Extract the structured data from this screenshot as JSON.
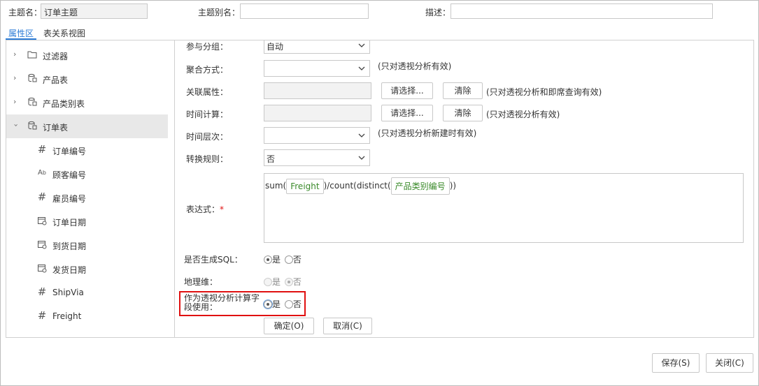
{
  "header": {
    "topic_name_label": "主题名：",
    "topic_name_value": "订单主题",
    "alias_label": "主题别名：",
    "alias_value": "",
    "desc_label": "描述：",
    "desc_value": ""
  },
  "tabs": [
    {
      "label": "属性区",
      "active": true
    },
    {
      "label": "表关系视图",
      "active": false
    }
  ],
  "tree": [
    {
      "label": "过滤器",
      "icon": "folder-icon",
      "expandable": true,
      "level": 0
    },
    {
      "label": "产品表",
      "icon": "table-icon",
      "expandable": true,
      "level": 0
    },
    {
      "label": "产品类别表",
      "icon": "table-icon",
      "expandable": true,
      "level": 0
    },
    {
      "label": "订单表",
      "icon": "table-icon",
      "expandable": true,
      "expanded": true,
      "selected": true,
      "level": 0
    },
    {
      "label": "订单编号",
      "icon": "number-field-icon",
      "level": 1
    },
    {
      "label": "顾客编号",
      "icon": "text-field-icon",
      "level": 1
    },
    {
      "label": "雇员编号",
      "icon": "number-field-icon",
      "level": 1
    },
    {
      "label": "订单日期",
      "icon": "date-field-icon",
      "level": 1
    },
    {
      "label": "到货日期",
      "icon": "date-field-icon",
      "level": 1
    },
    {
      "label": "发货日期",
      "icon": "date-field-icon",
      "level": 1
    },
    {
      "label": "ShipVia",
      "icon": "number-field-icon",
      "level": 1
    },
    {
      "label": "Freight",
      "icon": "number-field-icon",
      "level": 1
    }
  ],
  "form": {
    "group_label": "参与分组：",
    "group_value": "自动",
    "agg_label": "聚合方式：",
    "agg_value": "",
    "agg_hint": "(只对透视分析有效)",
    "rel_label": "关联属性：",
    "rel_select_btn": "请选择...",
    "rel_clear_btn": "清除",
    "rel_hint": "(只对透视分析和即席查询有效)",
    "time_calc_label": "时间计算：",
    "time_calc_select_btn": "请选择...",
    "time_calc_clear_btn": "清除",
    "time_calc_hint": "(只对透视分析有效)",
    "time_level_label": "时间层次：",
    "time_level_value": "",
    "time_level_hint": "(只对透视分析新建时有效)",
    "conv_label": "转换规则：",
    "conv_value": "否",
    "expr_label": "表达式：",
    "expr_required": "*",
    "expr_part1": "sum(",
    "expr_chip1": "Freight",
    "expr_part2": ")/count(distinct(",
    "expr_chip2": "产品类别编号",
    "expr_part3": "))",
    "sql_label": "是否生成SQL：",
    "sql_yes": "是",
    "sql_no": "否",
    "geo_label": "地理维：",
    "geo_yes": "是",
    "geo_no": "否",
    "pivot_label": "作为透视分析计算字段使用：",
    "pivot_yes": "是",
    "pivot_no": "否",
    "ok_btn": "确定(O)",
    "cancel_btn": "取消(C)"
  },
  "footer": {
    "save_btn": "保存(S)",
    "close_btn": "关闭(C)"
  },
  "colors": {
    "accent": "#2b7bd6",
    "highlight_border": "#e01010",
    "chip_text": "#3a8a2a"
  }
}
